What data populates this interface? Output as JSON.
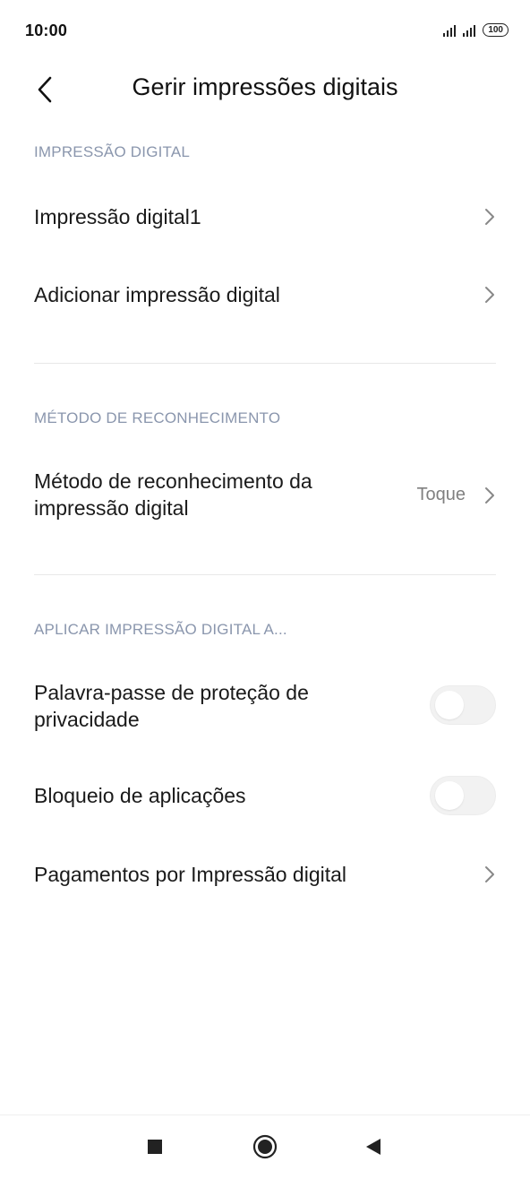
{
  "status_bar": {
    "time": "10:00",
    "battery": "100",
    "icons": [
      "signal-icon",
      "signal-icon",
      "battery-icon"
    ]
  },
  "header": {
    "title": "Gerir impressões digitais",
    "back_icon": "back-arrow-icon"
  },
  "sections": [
    {
      "header": "IMPRESSÃO DIGITAL",
      "items": [
        {
          "label": "Impressão digital1",
          "control": "chevron"
        },
        {
          "label": "Adicionar impressão digital",
          "control": "chevron"
        }
      ]
    },
    {
      "header": "MÉTODO DE RECONHECIMENTO",
      "items": [
        {
          "label_line1": "Método de reconhecimento da",
          "label_line2": "impressão digital",
          "value": "Toque",
          "control": "chevron"
        }
      ]
    },
    {
      "header": "APLICAR IMPRESSÃO DIGITAL A...",
      "items": [
        {
          "label_line1": "Palavra-passe de proteção de",
          "label_line2": "privacidade",
          "control": "toggle",
          "state": "off"
        },
        {
          "label": "Bloqueio de aplicações",
          "control": "toggle",
          "state": "off"
        },
        {
          "label": "Pagamentos por Impressão digital",
          "control": "chevron"
        }
      ]
    }
  ],
  "nav_bar": {
    "icons": [
      "recents-square-icon",
      "home-circle-icon",
      "back-triangle-icon"
    ]
  },
  "colors": {
    "section_header": "#8a96ad",
    "text": "#1a1a1a",
    "secondary_text": "#808080",
    "chevron": "#888888",
    "toggle_track": "#f2f2f2"
  }
}
